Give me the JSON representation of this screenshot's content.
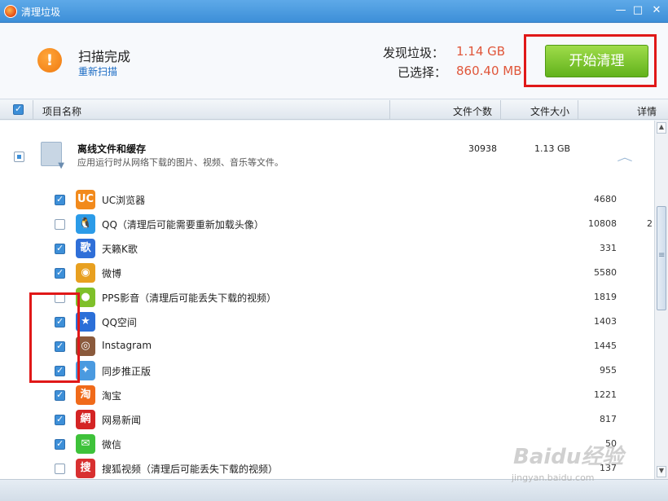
{
  "window": {
    "title": "清理垃圾",
    "minimize": "—",
    "maximize": "□",
    "close": "✕"
  },
  "header": {
    "status": "扫描完成",
    "rescan": "重新扫描",
    "found_label": "发现垃圾：",
    "found_value": "1.14 GB",
    "selected_label": "已选择：",
    "selected_value": "860.40 MB",
    "start_button": "开始清理",
    "warning_symbol": "!"
  },
  "columns": {
    "name": "项目名称",
    "count": "文件个数",
    "size": "文件大小",
    "detail": "详情"
  },
  "group": {
    "title": "离线文件和缓存",
    "desc": "应用运行时从网络下载的图片、视频、音乐等文件。",
    "count": "30938",
    "size": "1.13 GB",
    "collapse_symbol": "︿"
  },
  "items": [
    {
      "name": "UC浏览器",
      "count": "4680",
      "checked": true,
      "icon_text": "UC",
      "icon_color": "#f28a1c"
    },
    {
      "name": "QQ（清理后可能需要重新加载头像）",
      "count": "10808",
      "extra": "2",
      "checked": false,
      "icon_text": "🐧",
      "icon_color": "#2b9be8"
    },
    {
      "name": "天籁K歌",
      "count": "331",
      "checked": true,
      "icon_text": "歌",
      "icon_color": "#2f6fd8"
    },
    {
      "name": "微博",
      "count": "5580",
      "checked": true,
      "icon_text": "◉",
      "icon_color": "#e8a020"
    },
    {
      "name": "PPS影音（清理后可能丢失下载的视频）",
      "count": "1819",
      "checked": false,
      "icon_text": "●",
      "icon_color": "#7fc02a"
    },
    {
      "name": "QQ空间",
      "count": "1403",
      "checked": true,
      "icon_text": "★",
      "icon_color": "#2b6fd8"
    },
    {
      "name": "Instagram",
      "count": "1445",
      "checked": true,
      "icon_text": "◎",
      "icon_color": "#8a5a3c"
    },
    {
      "name": "同步推正版",
      "count": "955",
      "checked": true,
      "icon_text": "✦",
      "icon_color": "#4a9ae0"
    },
    {
      "name": "淘宝",
      "count": "1221",
      "checked": true,
      "icon_text": "淘",
      "icon_color": "#f06a1a"
    },
    {
      "name": "网易新闻",
      "count": "817",
      "checked": true,
      "icon_text": "網",
      "icon_color": "#d42424"
    },
    {
      "name": "微信",
      "count": "50",
      "checked": true,
      "icon_text": "✉",
      "icon_color": "#3ec23a"
    },
    {
      "name": "搜狐视频（清理后可能丢失下载的视频）",
      "count": "137",
      "checked": false,
      "icon_text": "搜",
      "icon_color": "#d83030"
    }
  ],
  "watermark": {
    "main": "Baidu经验",
    "sub": "jingyan.baidu.com"
  },
  "colors": {
    "accent": "#3d8fd8",
    "highlight": "#e01818",
    "value": "#e0563a",
    "button": "#62b21c"
  }
}
